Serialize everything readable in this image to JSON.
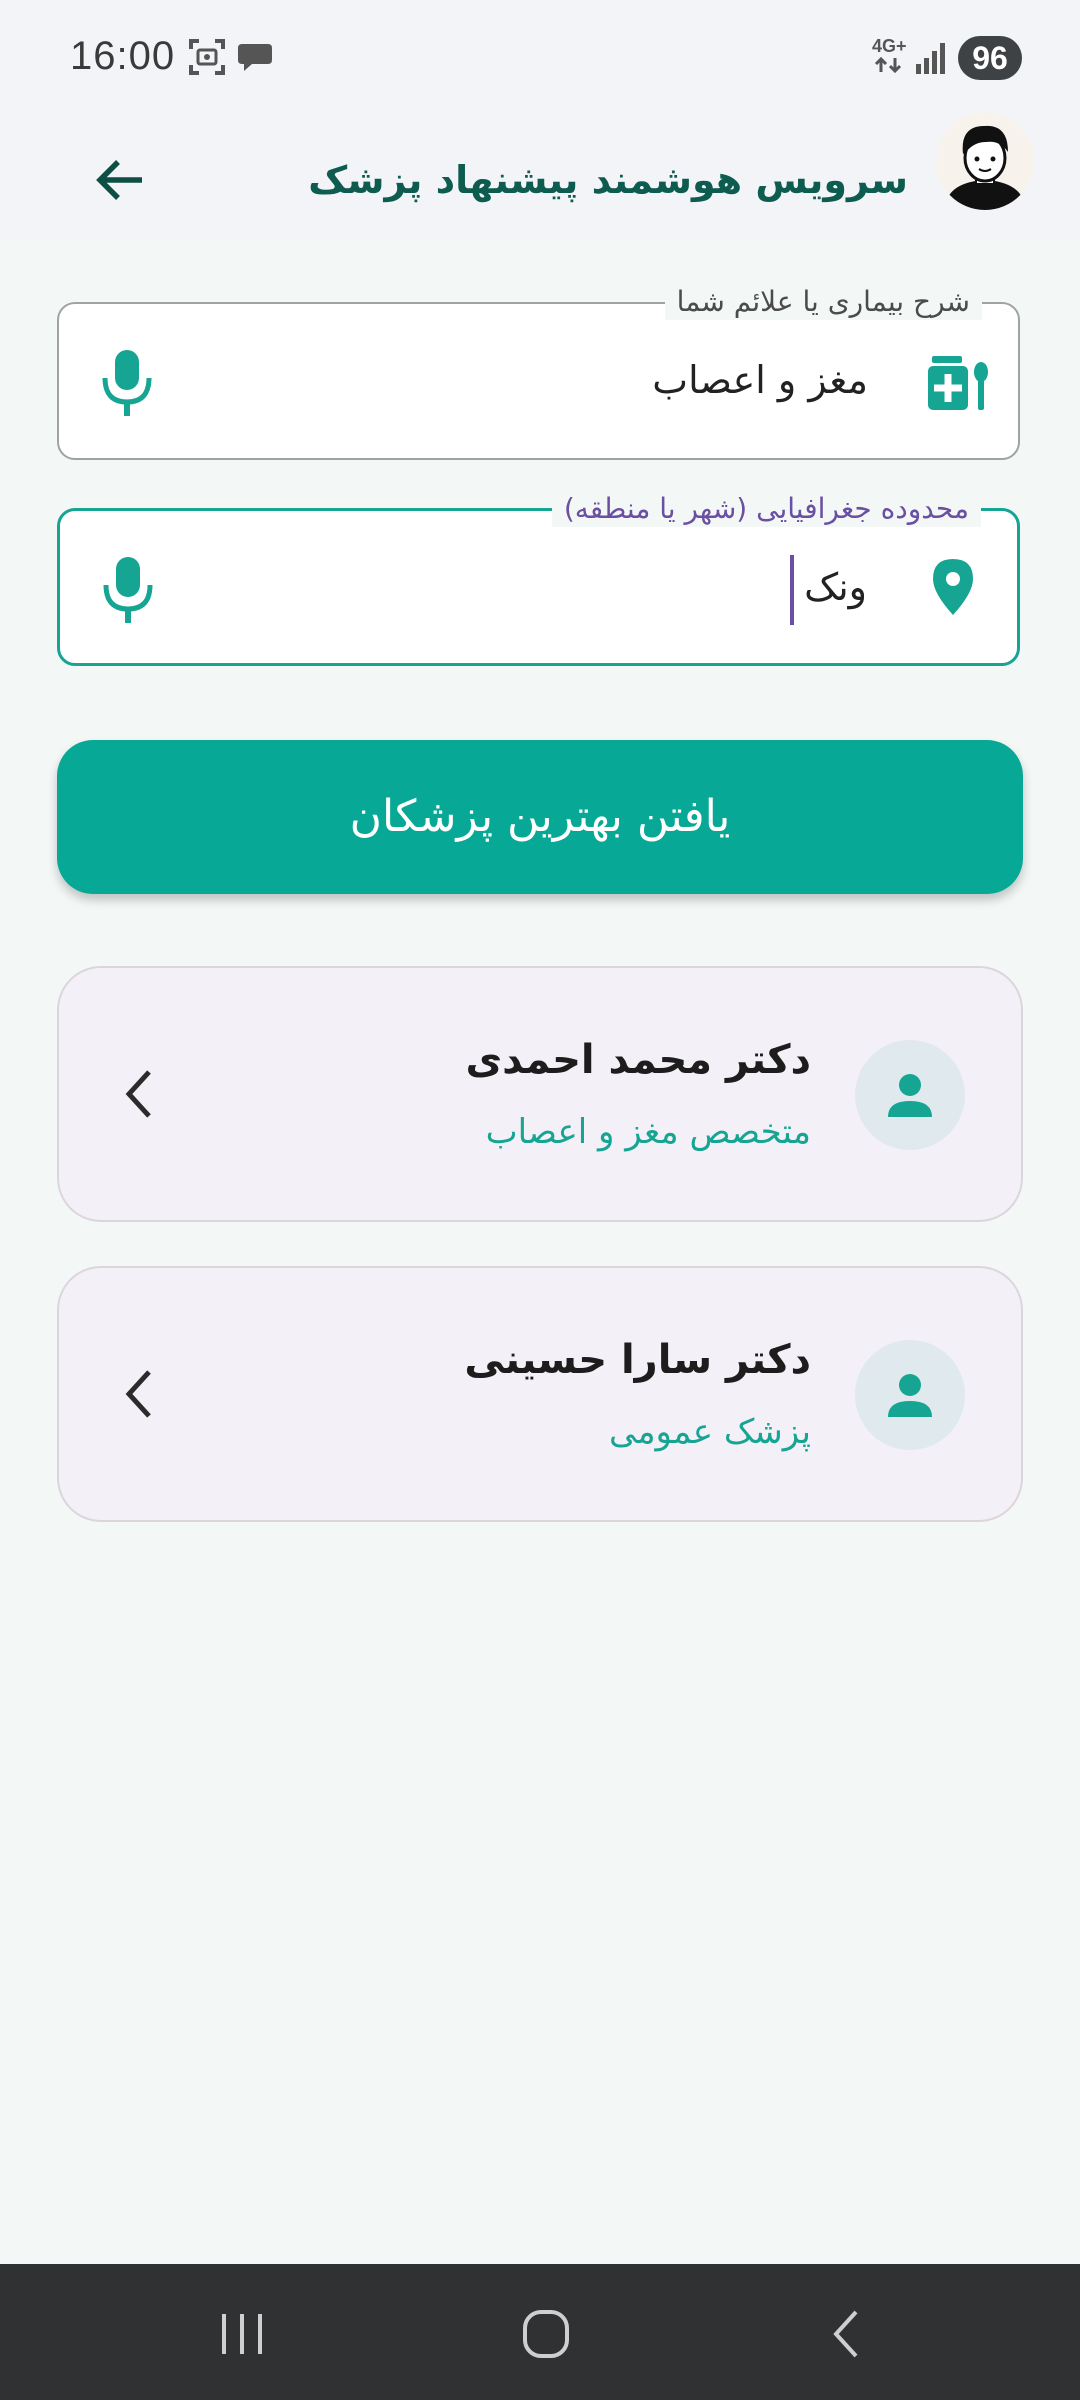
{
  "status_bar": {
    "time": "16:00",
    "network": "4G+",
    "battery": "96",
    "icons": [
      "screenshot-icon",
      "chat-bubble-icon",
      "network-4g-icon",
      "signal-icon"
    ]
  },
  "app_bar": {
    "title": "سرویس هوشمند پیشنهاد پزشک",
    "back_icon": "arrow-back-icon"
  },
  "form": {
    "symptoms": {
      "label": "شرح بیماری یا علائم شما",
      "value": "مغز و اعصاب",
      "icon": "medical-services-icon"
    },
    "location": {
      "label": "محدوده جغرافیایی (شهر یا منطقه)",
      "value": "ونک",
      "icon": "location-pin-icon"
    },
    "submit_label": "یافتن بهترین پزشکان"
  },
  "results": [
    {
      "name": "دکتر محمد احمدی",
      "specialty": "متخصص مغز و اعصاب"
    },
    {
      "name": "دکتر سارا حسینی",
      "specialty": "پزشک عمومی"
    }
  ],
  "colors": {
    "accent": "#07a895",
    "title": "#0d5c4f",
    "focus_label": "#6a4fa2",
    "card": "#f4f0f7"
  }
}
